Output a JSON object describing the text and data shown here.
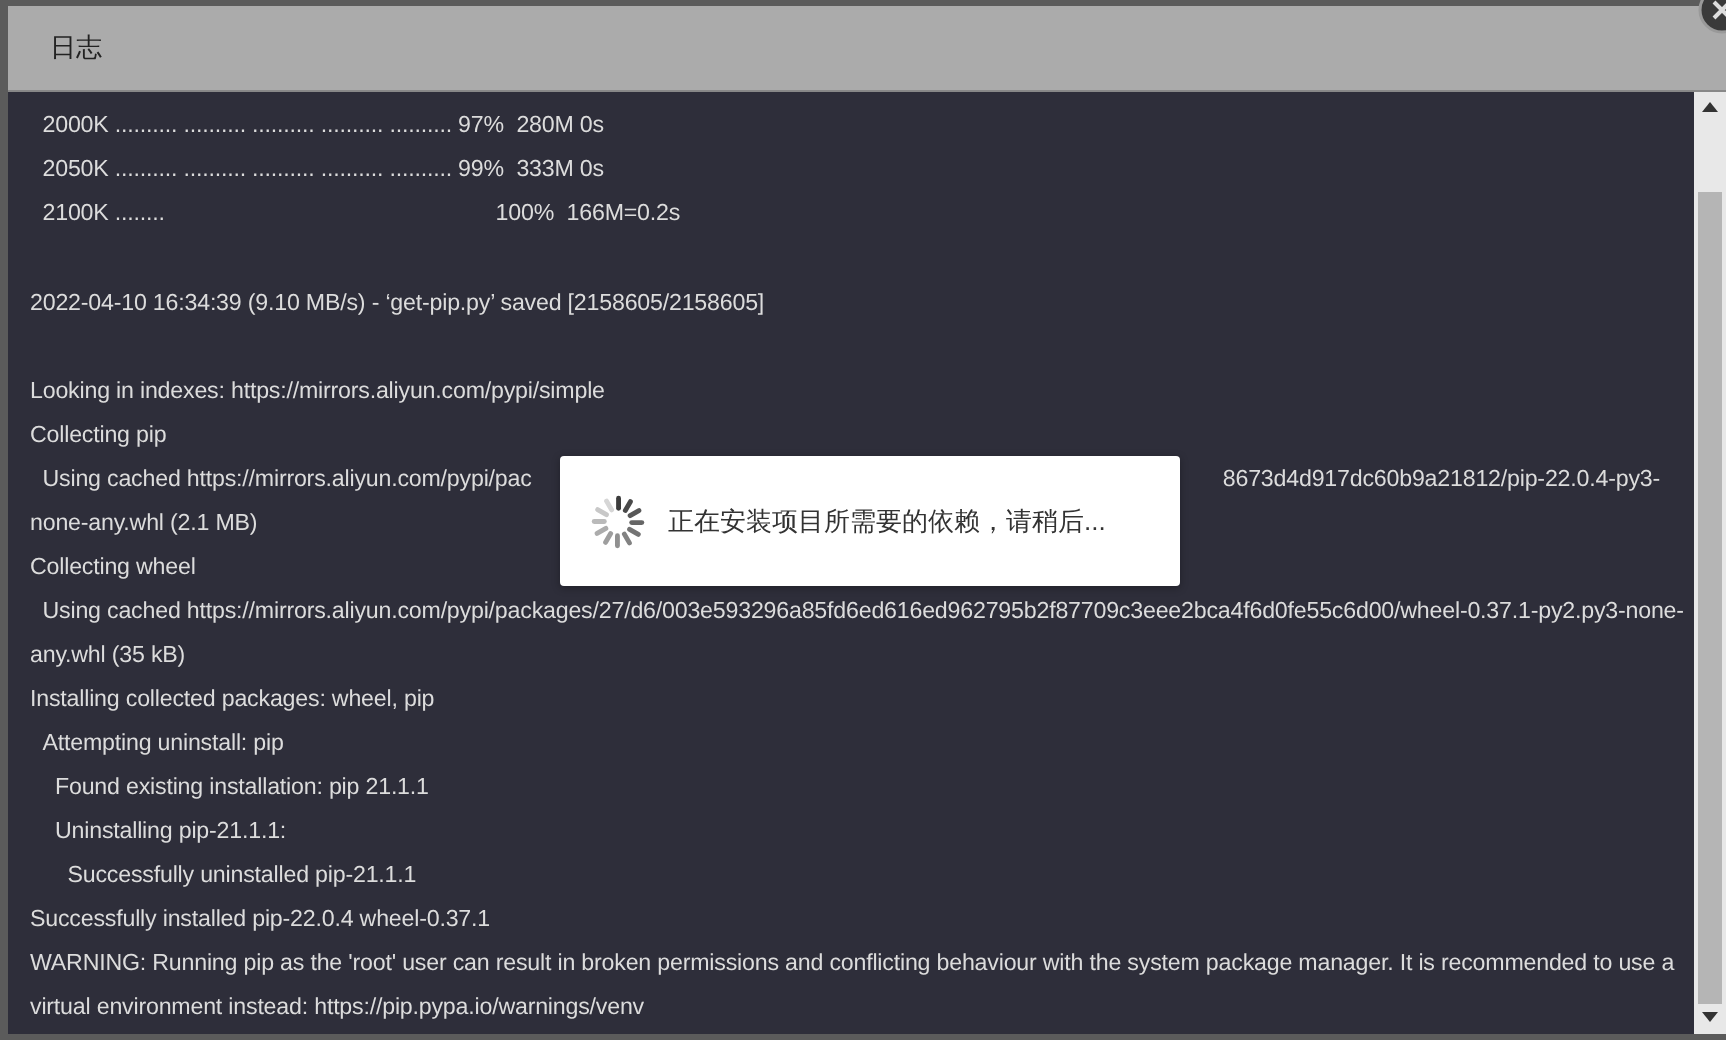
{
  "dialog": {
    "title": "日志"
  },
  "log_blocks": [
    [
      {
        "text": "  2000K .......... .......... .......... .......... .......... 97%  280M 0s"
      },
      {
        "text": "  2050K .......... .......... .......... .......... .......... 99%  333M 0s"
      },
      {
        "text": "  2100K ........                                                     100%  166M=0.2s"
      }
    ],
    [
      {
        "text": "2022-04-10 16:34:39 (9.10 MB/s) - ‘get-pip.py’ saved [2158605/2158605]"
      }
    ],
    [
      {
        "text": "Looking in indexes: https://mirrors.aliyun.com/pypi/simple"
      },
      {
        "text": "Collecting pip"
      },
      {
        "kind": "covered",
        "left": "  Using cached https://mirrors.aliyun.com/pypi/pac",
        "right": "8673d4d917dc60b9a21812/pip-22.0.4-py3-"
      },
      {
        "text": "none-any.whl (2.1 MB)"
      },
      {
        "text": "Collecting wheel"
      },
      {
        "text": "  Using cached https://mirrors.aliyun.com/pypi/packages/27/d6/003e593296a85fd6ed616ed962795b2f87709c3eee2bca4f6d0fe55c6d00/wheel-0.37.1-py2.py3-none-any.whl (35 kB)"
      },
      {
        "text": "Installing collected packages: wheel, pip"
      },
      {
        "text": "  Attempting uninstall: pip"
      },
      {
        "text": "    Found existing installation: pip 21.1.1"
      },
      {
        "text": "    Uninstalling pip-21.1.1:"
      },
      {
        "text": "      Successfully uninstalled pip-21.1.1"
      },
      {
        "text": "Successfully installed pip-22.0.4 wheel-0.37.1"
      },
      {
        "text": "WARNING: Running pip as the 'root' user can result in broken permissions and conflicting behaviour with the system package manager. It is recommended to use a virtual environment instead: https://pip.pypa.io/warnings/venv"
      }
    ]
  ],
  "loading": {
    "message": "正在安装项目所需要的依赖，请稍后..."
  }
}
